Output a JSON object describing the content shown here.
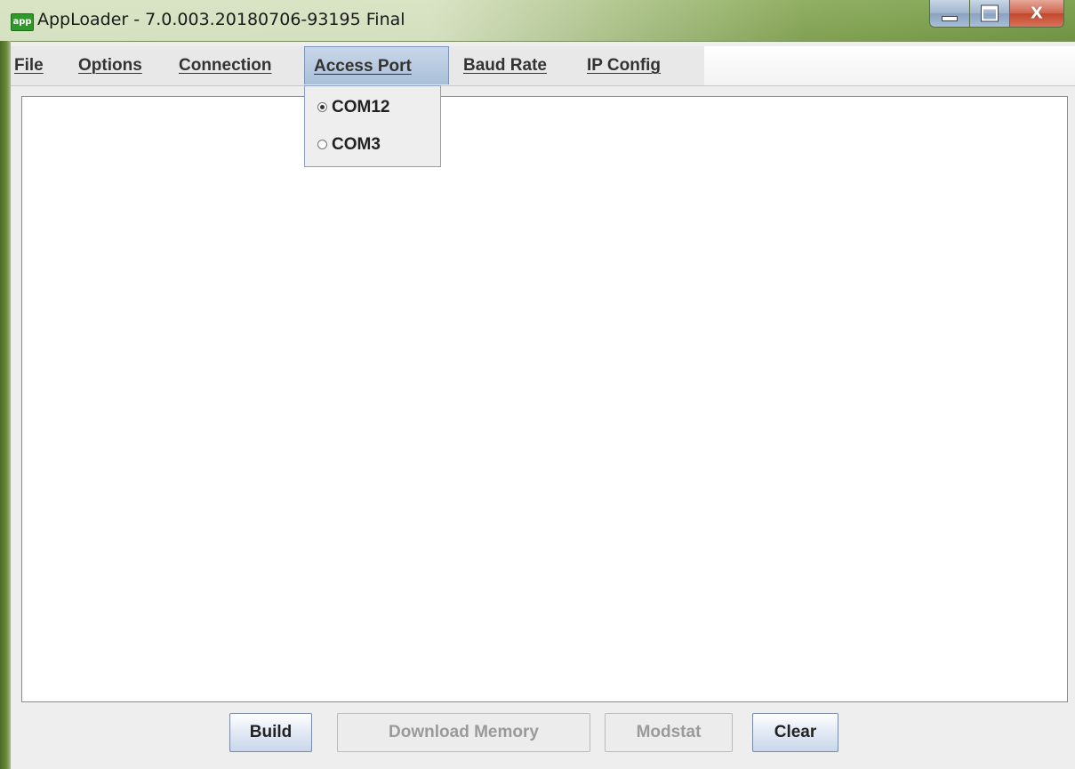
{
  "window": {
    "app_icon_text": "app",
    "title": "AppLoader - 7.0.003.20180706-93195 Final",
    "close_glyph": "X"
  },
  "menubar": {
    "items": [
      {
        "label": "File"
      },
      {
        "label": "Options"
      },
      {
        "label": "Connection"
      },
      {
        "label": "Access Port"
      },
      {
        "label": "Baud Rate"
      },
      {
        "label": "IP Config"
      }
    ],
    "active": "Access Port"
  },
  "access_port_menu": {
    "options": [
      {
        "label": "COM12",
        "selected": true
      },
      {
        "label": "COM3",
        "selected": false
      }
    ]
  },
  "output_area": {
    "text": ""
  },
  "buttons": {
    "build": {
      "label": "Build",
      "enabled": true
    },
    "download_memory": {
      "label": "Download Memory",
      "enabled": false
    },
    "modstat": {
      "label": "Modstat",
      "enabled": false
    },
    "clear": {
      "label": "Clear",
      "enabled": true
    }
  }
}
